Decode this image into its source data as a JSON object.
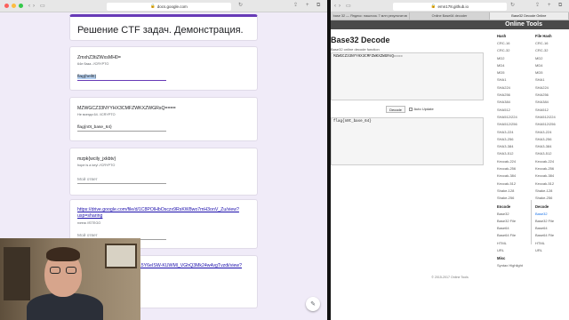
{
  "left_browser": {
    "url": "docs.google.com"
  },
  "form": {
    "title": "Решение CTF задач. Демонстрация.",
    "questions": [
      {
        "q": "ZmxhZ3tiZWxsMH0=",
        "hint": "64е база. //CRYPTO",
        "answer": "flag{hell0}",
        "state": "selected"
      },
      {
        "q": "MZWGCZ33NYYHX3CMFZWKXZWGRsQ====",
        "hint": "Не всегда 64. //CRYPTO",
        "answer": "flag{n0t_base_64}",
        "state": "filled"
      },
      {
        "q": "mzpk{wcily_jxkbtv}",
        "hint": "hope is a key! //CRYPTO",
        "answer": "Мой ответ",
        "state": "placeholder"
      },
      {
        "q": "https://drive.google.com/file/d/1C8POlHbOsczx9RsKW8wo7mH3onV_Zu/view?usp=sharing",
        "hint": "гипна //STEGO",
        "answer": "Мой ответ",
        "state": "placeholder"
      },
      {
        "q": "https://drive.google.com/file/d/15Y6eISW-KUWMl_VGhQ3Mk24w4vgTvzdi/view?",
        "hint": "",
        "answer": "",
        "state": "link"
      }
    ]
  },
  "right_browser": {
    "url": "emn178.github.io",
    "tabs": [
      "base 32 — Яндекс: нашлось 7 млн результатов",
      "Online Base64 decoder",
      "Base32 Decode Online"
    ]
  },
  "tool": {
    "brand": "Online Tools",
    "title": "Base32 Decode",
    "subtitle": "Base32 online decode function",
    "input": "MZWGCZ33NYYHX3CMFZWKXZWGRsQ====",
    "decode_label": "Decode",
    "auto_update_label": "Auto Update",
    "output": "flag{n0t_base_64}",
    "footer": "© 2015-2017 Online Tools"
  },
  "menu_hash": {
    "header": "Hash",
    "items": [
      "CRC-16",
      "CRC-32",
      "MD2",
      "MD4",
      "MD5",
      "SHA1",
      "SHA224",
      "SHA256",
      "SHA384",
      "SHA512",
      "SHA512/224",
      "SHA512/256",
      "SHA3-224",
      "SHA3-256",
      "SHA3-384",
      "SHA3-512",
      "Keccak-224",
      "Keccak-256",
      "Keccak-384",
      "Keccak-512",
      "Shake-128",
      "Shake-256"
    ]
  },
  "menu_file_hash": {
    "header": "File Hash",
    "items": [
      "CRC-16",
      "CRC-32",
      "MD2",
      "MD4",
      "MD5",
      "SHA1",
      "SHA224",
      "SHA256",
      "SHA384",
      "SHA512",
      "SHA512/224",
      "SHA512/256",
      "SHA3-224",
      "SHA3-256",
      "SHA3-384",
      "SHA3-512",
      "Keccak-224",
      "Keccak-256",
      "Keccak-384",
      "Keccak-512",
      "Shake-128",
      "Shake-256"
    ]
  },
  "menu_encode": {
    "header": "Encode",
    "items": [
      "Base32",
      "Base32 File",
      "Base64",
      "Base64 File",
      "HTML",
      "URL"
    ]
  },
  "menu_decode": {
    "header": "Decode",
    "items": [
      "Base32",
      "Base32 File",
      "Base64",
      "Base64 File",
      "HTML",
      "URL"
    ],
    "active": "Base32"
  },
  "menu_misc": {
    "header": "Misc",
    "items": [
      "Syntax Highlight"
    ]
  },
  "colors": {
    "form_accent": "#673ab7",
    "form_bg": "#f0ebf8",
    "tools_header": "#4a4a4a",
    "link": "#1a0dab"
  }
}
